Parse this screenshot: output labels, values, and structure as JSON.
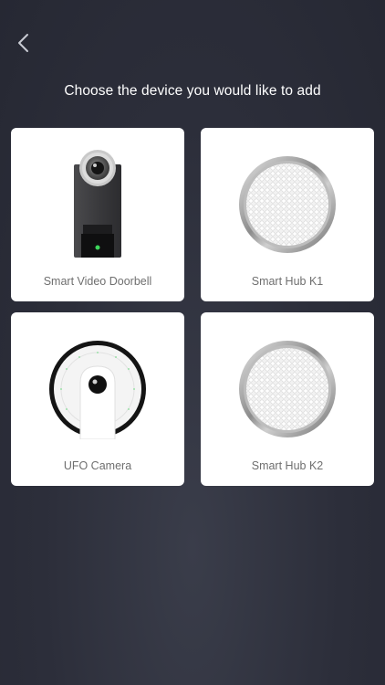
{
  "header": {
    "title": "Choose the device you would like to add"
  },
  "devices": [
    {
      "label": "Smart Video Doorbell",
      "icon": "doorbell-icon"
    },
    {
      "label": "Smart Hub K1",
      "icon": "hub-icon"
    },
    {
      "label": "UFO Camera",
      "icon": "ufo-camera-icon"
    },
    {
      "label": "Smart Hub K2",
      "icon": "hub-icon"
    }
  ],
  "colors": {
    "background": "#2c2e3a",
    "card": "#ffffff",
    "label": "#6f6f6f",
    "led": "#3dd65c"
  }
}
